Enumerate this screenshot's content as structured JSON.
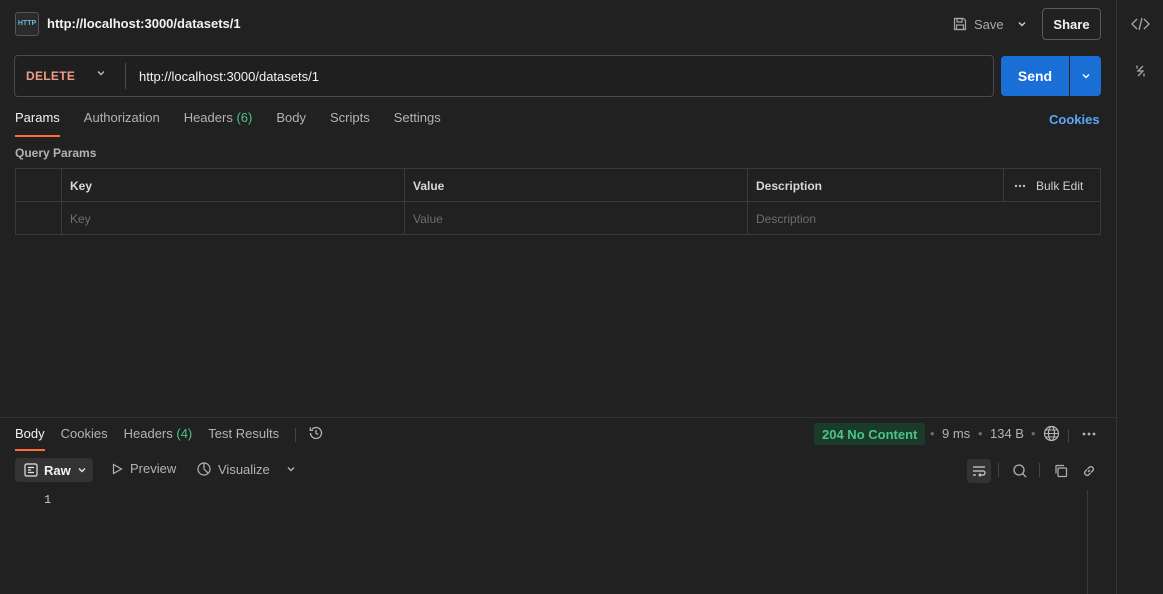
{
  "request": {
    "icon_text": "HTTP",
    "title": "http://localhost:3000/datasets/1",
    "method": "DELETE",
    "url": "http://localhost:3000/datasets/1"
  },
  "toolbar": {
    "save_label": "Save",
    "share_label": "Share",
    "send_label": "Send"
  },
  "request_tabs": {
    "params": "Params",
    "authorization": "Authorization",
    "headers": "Headers",
    "headers_count": "(6)",
    "body": "Body",
    "scripts": "Scripts",
    "settings": "Settings",
    "cookies": "Cookies"
  },
  "query_params": {
    "section_label": "Query Params",
    "columns": {
      "key": "Key",
      "value": "Value",
      "description": "Description"
    },
    "bulk_edit": "Bulk Edit",
    "placeholders": {
      "key": "Key",
      "value": "Value",
      "description": "Description"
    }
  },
  "response_tabs": {
    "body": "Body",
    "cookies": "Cookies",
    "headers": "Headers",
    "headers_count": "(4)",
    "test_results": "Test Results"
  },
  "response": {
    "status": "204 No Content",
    "time": "9 ms",
    "size": "134 B",
    "format": "Raw",
    "preview": "Preview",
    "visualize": "Visualize",
    "line_number": "1"
  },
  "colors": {
    "accent_orange": "#ff6c37",
    "method_delete": "#f09c84",
    "send_blue": "#1a6fd6",
    "status_green": "#4cc38a",
    "link_blue": "#5aa6ff"
  }
}
